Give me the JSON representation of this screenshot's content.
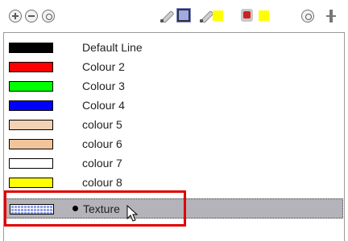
{
  "toolbar": {
    "buttons": [
      {
        "name": "add-colour-button",
        "icon": "plus-circle-icon"
      },
      {
        "name": "remove-colour-button",
        "icon": "minus-circle-icon"
      },
      {
        "name": "link-palette-button",
        "icon": "link-icon"
      },
      {
        "name": "edit-colour-pencil-button",
        "icon": "pencil-icon"
      },
      {
        "name": "fill-colour-swatch",
        "icon": "fill-swatch-icon"
      },
      {
        "name": "line-colour-pencil-button",
        "icon": "pencil-icon"
      },
      {
        "name": "tint-button",
        "icon": "tint-icon"
      },
      {
        "name": "reset-button",
        "icon": "reset-icon"
      },
      {
        "name": "move-arrows-button",
        "icon": "move-icon"
      }
    ],
    "colors": {
      "yellow": "#ffff00",
      "selected_swatch": "#9fa9e6",
      "red_tile": "#cc2222"
    }
  },
  "palette": {
    "rows": [
      {
        "label": "Default Line",
        "color": "#000000"
      },
      {
        "label": "Colour 2",
        "color": "#ff0000"
      },
      {
        "label": "Colour 3",
        "color": "#00ff00"
      },
      {
        "label": "Colour 4",
        "color": "#0000ff"
      },
      {
        "label": "colour 5",
        "color": "#f2d1b5"
      },
      {
        "label": "colour 6",
        "color": "#f2c49b"
      },
      {
        "label": "colour 7",
        "color": "#ffffff"
      },
      {
        "label": "colour 8",
        "color": "#ffff00"
      }
    ],
    "selected": {
      "label": "Texture",
      "type": "texture",
      "color": "#8fa0e8"
    }
  },
  "annotation": {
    "highlight_color": "#e00000"
  }
}
